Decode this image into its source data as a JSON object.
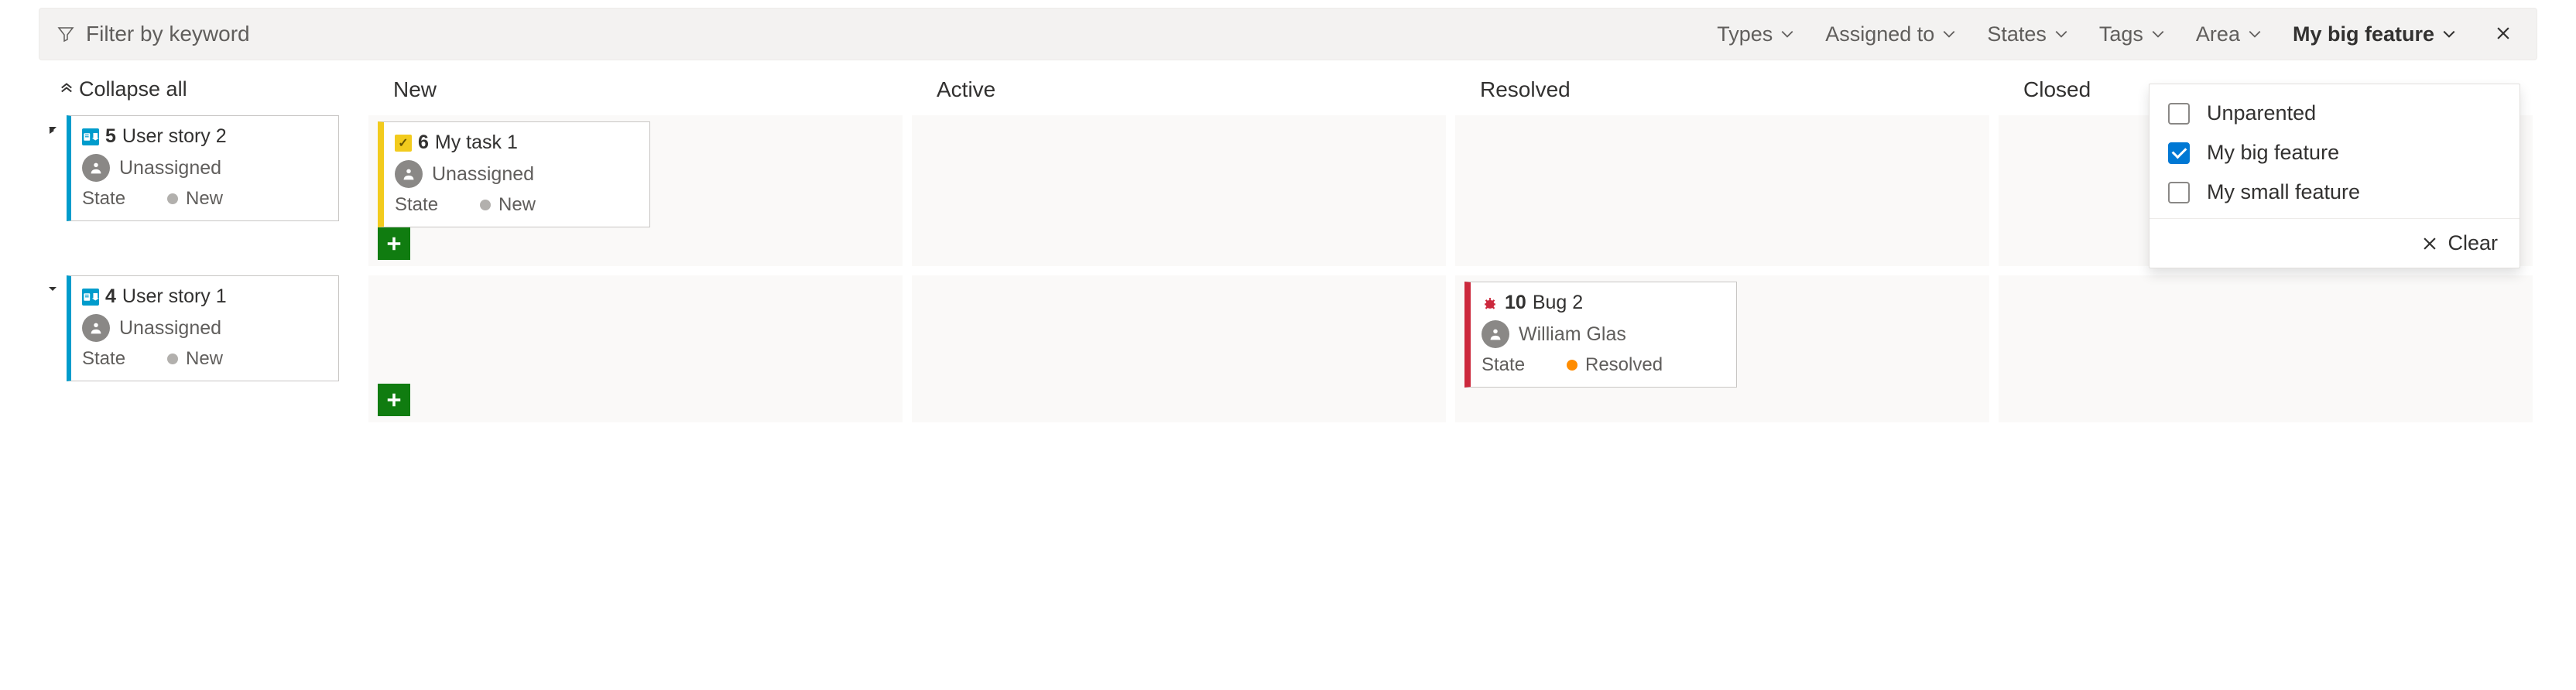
{
  "filter": {
    "placeholder": "Filter by keyword",
    "dropdowns": {
      "types": "Types",
      "assigned_to": "Assigned to",
      "states": "States",
      "tags": "Tags",
      "area": "Area",
      "parent": "My big feature"
    },
    "parent_panel": {
      "options": [
        {
          "label": "Unparented",
          "checked": false
        },
        {
          "label": "My big feature",
          "checked": true
        },
        {
          "label": "My small feature",
          "checked": false
        }
      ],
      "clear_label": "Clear"
    }
  },
  "collapse_all_label": "Collapse all",
  "columns": [
    "New",
    "Active",
    "Resolved",
    "Closed"
  ],
  "rows": [
    {
      "parent": {
        "id": "5",
        "title": "User story 2",
        "assignee": "Unassigned",
        "state_label": "State",
        "state": "New"
      },
      "lanes": {
        "New": [
          {
            "type": "task",
            "id": "6",
            "title": "My task 1",
            "assignee": "Unassigned",
            "state_label": "State",
            "state": "New"
          }
        ],
        "Active": [],
        "Resolved": [],
        "Closed": []
      }
    },
    {
      "parent": {
        "id": "4",
        "title": "User story 1",
        "assignee": "Unassigned",
        "state_label": "State",
        "state": "New"
      },
      "lanes": {
        "New": [],
        "Active": [],
        "Resolved": [
          {
            "type": "bug",
            "id": "10",
            "title": "Bug 2",
            "assignee": "William Glas",
            "state_label": "State",
            "state": "Resolved"
          }
        ],
        "Closed": []
      }
    }
  ]
}
